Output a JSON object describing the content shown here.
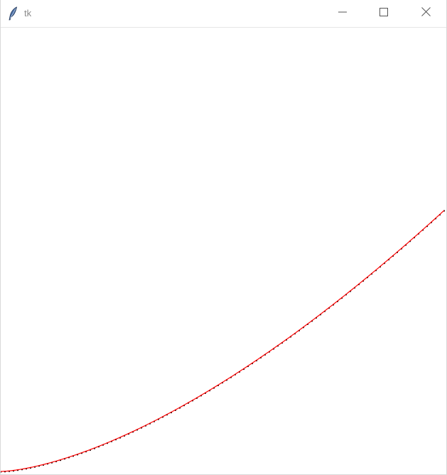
{
  "window": {
    "title": "tk"
  },
  "icons": {
    "app": "feather-icon",
    "minimize": "minimize-icon",
    "maximize": "maximize-icon",
    "close": "close-icon"
  },
  "canvas": {
    "background": "#ffffff",
    "curve_color": "#ff0000",
    "marker_color": "#000000"
  }
}
